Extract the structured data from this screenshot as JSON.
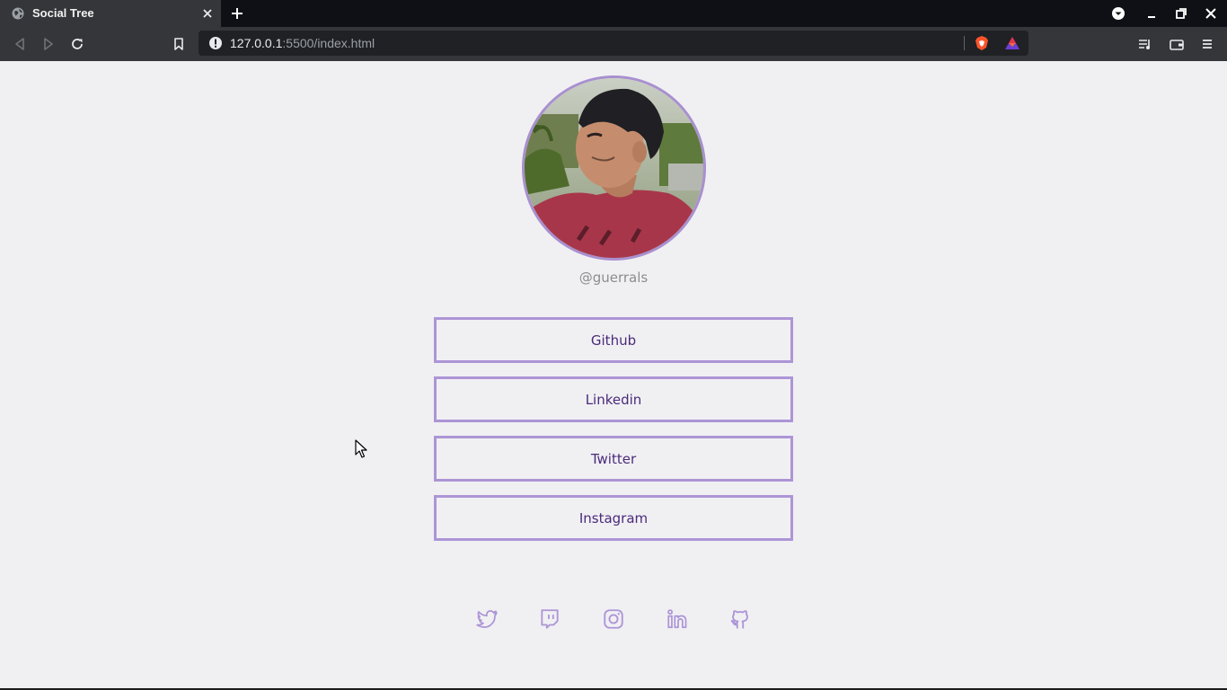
{
  "browser": {
    "tab_title": "Social Tree",
    "url_host": "127.0.0.1",
    "url_rest": ":5500/index.html"
  },
  "profile": {
    "handle": "@guerrals"
  },
  "links": [
    {
      "label": "Github"
    },
    {
      "label": "Linkedin"
    },
    {
      "label": "Twitter"
    },
    {
      "label": "Instagram"
    }
  ],
  "social_icons": [
    "twitter-icon",
    "twitch-icon",
    "instagram-icon",
    "linkedin-icon",
    "github-icon"
  ],
  "colors": {
    "accent": "#ad95d6",
    "button_text": "#4b2a7a",
    "handle_text": "#8d8d8d",
    "page_bg": "#f0f0f3"
  }
}
